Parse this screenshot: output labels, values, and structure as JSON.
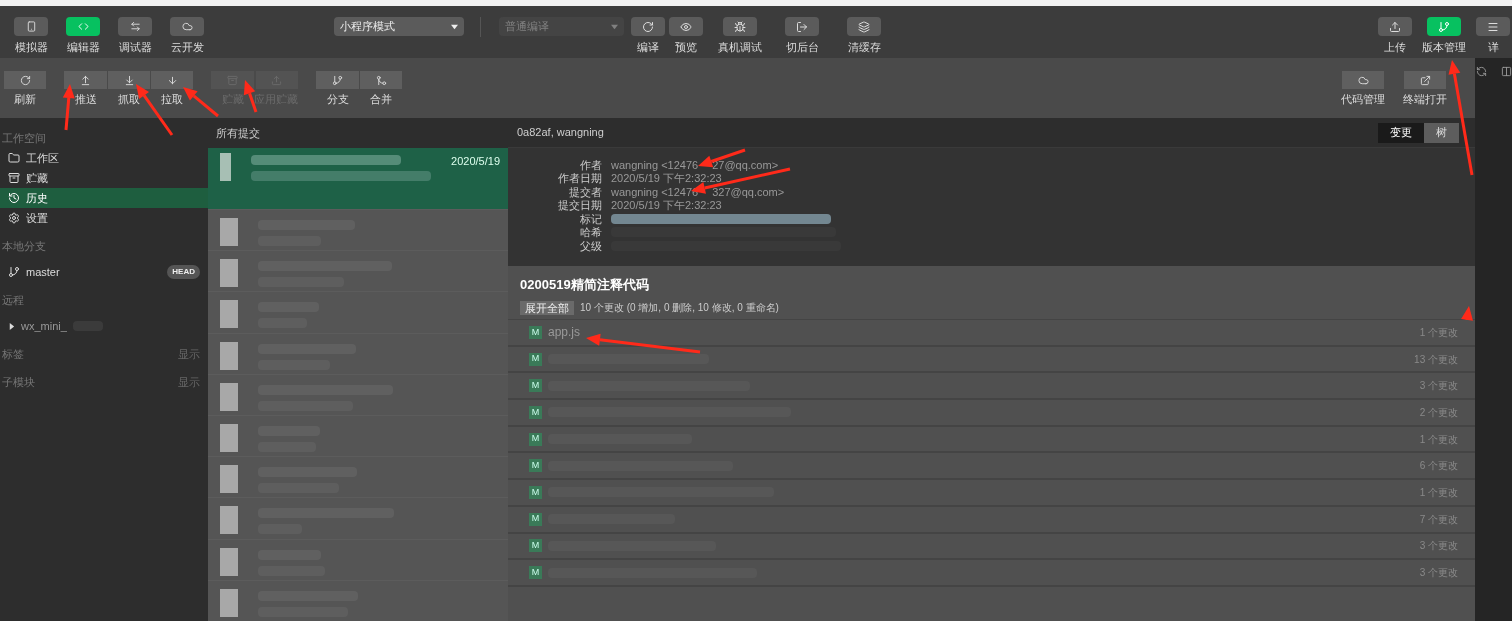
{
  "top_toolbar": {
    "left_buttons": [
      {
        "label": "模拟器",
        "selected": false
      },
      {
        "label": "编辑器",
        "selected": true
      },
      {
        "label": "调试器",
        "selected": false
      },
      {
        "label": "云开发",
        "selected": false
      }
    ],
    "mode_select": {
      "value": "小程序模式"
    },
    "compile_select": {
      "value": "普通编译",
      "disabled": true
    },
    "center_buttons": [
      {
        "label": "编译"
      },
      {
        "label": "预览"
      },
      {
        "label": "真机调试"
      },
      {
        "label": "切后台"
      },
      {
        "label": "清缓存"
      }
    ],
    "right_buttons": [
      {
        "label": "上传",
        "selected": false
      },
      {
        "label": "版本管理",
        "selected": true
      },
      {
        "label": "详",
        "selected": false
      }
    ]
  },
  "git_toolbar": {
    "groups": [
      [
        {
          "label": "刷新",
          "disabled": false
        }
      ],
      [
        {
          "label": "推送",
          "disabled": false
        },
        {
          "label": "抓取",
          "disabled": false
        },
        {
          "label": "拉取",
          "disabled": false
        }
      ],
      [
        {
          "label": "贮藏",
          "disabled": true
        },
        {
          "label": "应用贮藏",
          "disabled": true
        }
      ],
      [
        {
          "label": "分支",
          "disabled": false
        },
        {
          "label": "合并",
          "disabled": false
        }
      ]
    ],
    "right_buttons": [
      {
        "label": "代码管理"
      },
      {
        "label": "终端打开"
      }
    ]
  },
  "sidebar": {
    "sections": [
      {
        "title": "工作空间",
        "items": [
          {
            "label": "工作区",
            "selected": false
          },
          {
            "label": "贮藏",
            "selected": false
          },
          {
            "label": "历史",
            "selected": true
          },
          {
            "label": "设置",
            "selected": false
          }
        ]
      },
      {
        "title": "本地分支",
        "items": [
          {
            "label": "master",
            "badge": "HEAD",
            "selected": false
          }
        ]
      },
      {
        "title": "远程",
        "items": [
          {
            "label": "wx_mini_",
            "expanded": false,
            "selected": false
          }
        ]
      },
      {
        "title": "标签",
        "action": "显示"
      },
      {
        "title": "子模块",
        "action": "显示"
      }
    ]
  },
  "commit_list": {
    "title": "所有提交",
    "commits": [
      {
        "date": "2020/5/19",
        "selected": true
      },
      {
        "selected": false
      },
      {
        "selected": false
      },
      {
        "selected": false
      },
      {
        "selected": false
      },
      {
        "selected": false
      },
      {
        "selected": false
      },
      {
        "selected": false
      },
      {
        "selected": false
      },
      {
        "selected": false
      },
      {
        "selected": false
      }
    ]
  },
  "commit_detail": {
    "header": "0a82af, wangning",
    "view_tabs": [
      {
        "label": "变更",
        "selected": true
      },
      {
        "label": "树",
        "selected": false
      }
    ],
    "fields": [
      {
        "label": "作者",
        "value": "wangning <12476",
        "value_end": "27@qq.com>"
      },
      {
        "label": "作者日期",
        "value": "2020/5/19 下午2:32:23"
      },
      {
        "label": "提交者",
        "value": "wangning <12476",
        "value_end": "327@qq.com>"
      },
      {
        "label": "提交日期",
        "value": "2020/5/19 下午2:32:23"
      },
      {
        "label": "标记"
      },
      {
        "label": "哈希"
      },
      {
        "label": "父级"
      }
    ],
    "message": "0200519精简注释代码",
    "expand_all": "展开全部",
    "summary": "10 个更改 (0 增加, 0 删除, 10 修改, 0 重命名)",
    "files": [
      {
        "status": "M",
        "name": "app.js",
        "changes": "1 个更改"
      },
      {
        "status": "M",
        "changes": "13 个更改"
      },
      {
        "status": "M",
        "changes": "3 个更改"
      },
      {
        "status": "M",
        "changes": "2 个更改"
      },
      {
        "status": "M",
        "changes": "1 个更改"
      },
      {
        "status": "M",
        "changes": "6 个更改"
      },
      {
        "status": "M",
        "changes": "1 个更改"
      },
      {
        "status": "M",
        "changes": "7 个更改"
      },
      {
        "status": "M",
        "changes": "3 个更改"
      },
      {
        "status": "M",
        "changes": "3 个更改"
      }
    ]
  }
}
